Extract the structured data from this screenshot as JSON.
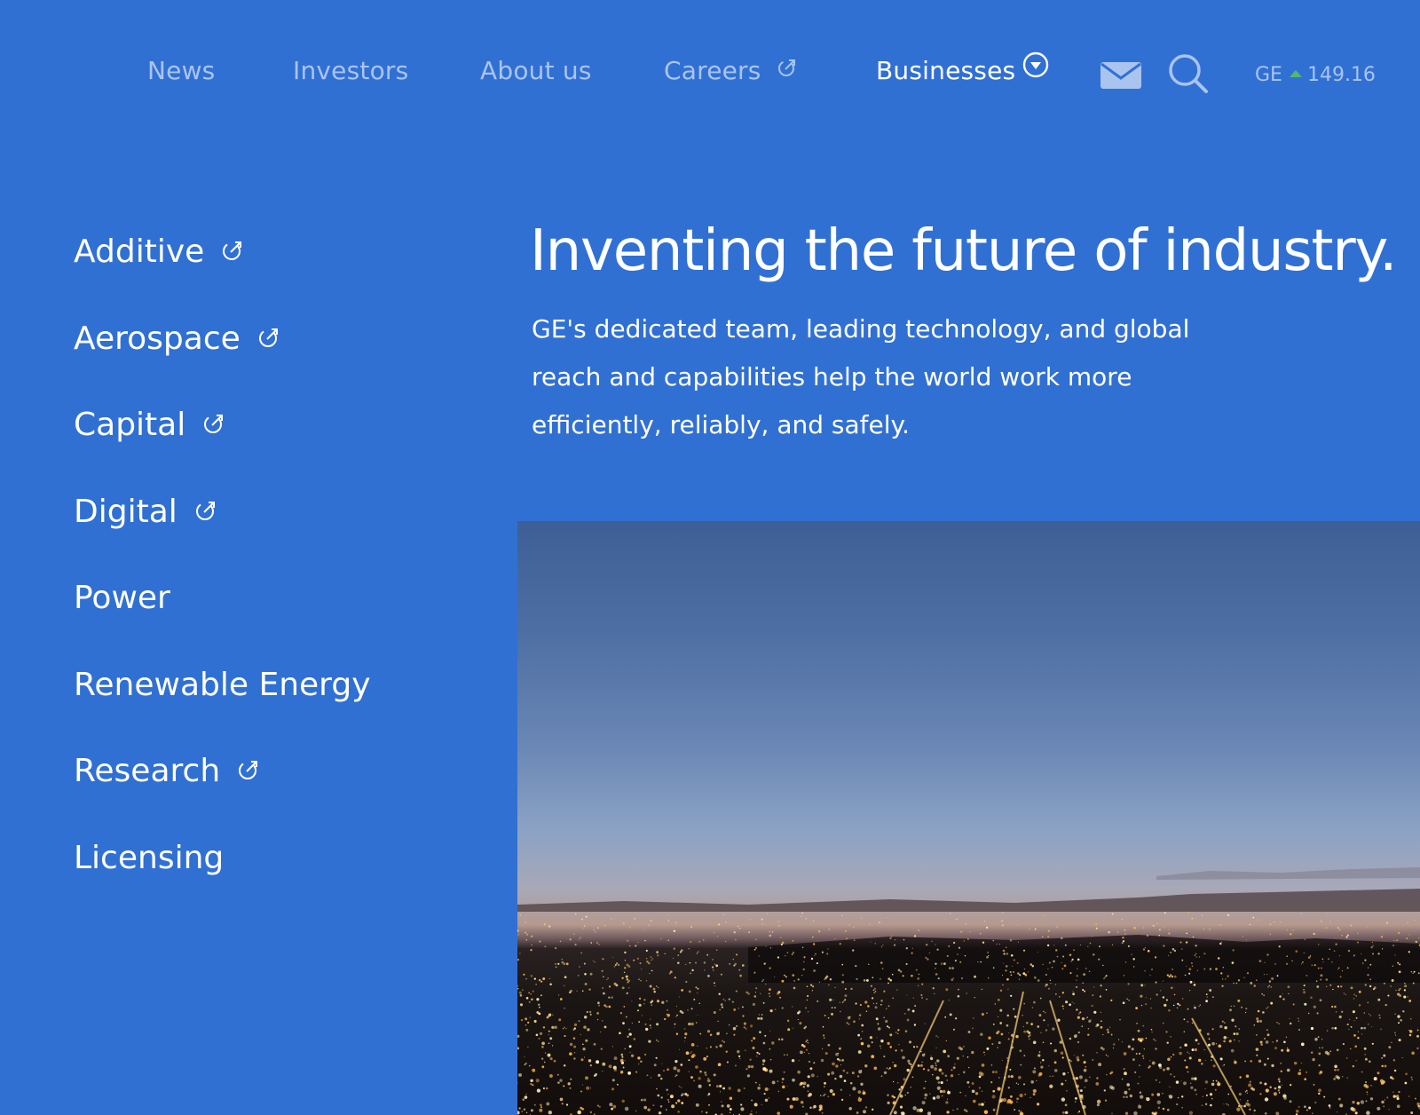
{
  "nav": {
    "items": [
      {
        "label": "News"
      },
      {
        "label": "Investors"
      },
      {
        "label": "About us"
      },
      {
        "label": "Careers",
        "icon": "external-link-icon"
      },
      {
        "label": "Businesses",
        "icon": "dropdown-circle-icon",
        "active": true
      }
    ],
    "mail_icon": "mail-icon",
    "search_icon": "search-icon",
    "stock": {
      "symbol": "GE",
      "direction": "up",
      "price": "149.16"
    }
  },
  "businesses": [
    {
      "label": "Additive",
      "external": true
    },
    {
      "label": "Aerospace",
      "external": true
    },
    {
      "label": "Capital",
      "external": true
    },
    {
      "label": "Digital",
      "external": true
    },
    {
      "label": "Power",
      "external": false
    },
    {
      "label": "Renewable Energy",
      "external": false
    },
    {
      "label": "Research",
      "external": true
    },
    {
      "label": "Licensing",
      "external": false
    }
  ],
  "hero": {
    "title": "Inventing the future of industry.",
    "text_lines": [
      "GE's dedicated team, leading technology, and global",
      "reach and capabilities help the world work more",
      "efficiently, reliably, and safely."
    ]
  },
  "colors": {
    "background": "#3170d3",
    "nav_inactive": "#a9c4ef",
    "stock_up": "#4fb87a"
  }
}
